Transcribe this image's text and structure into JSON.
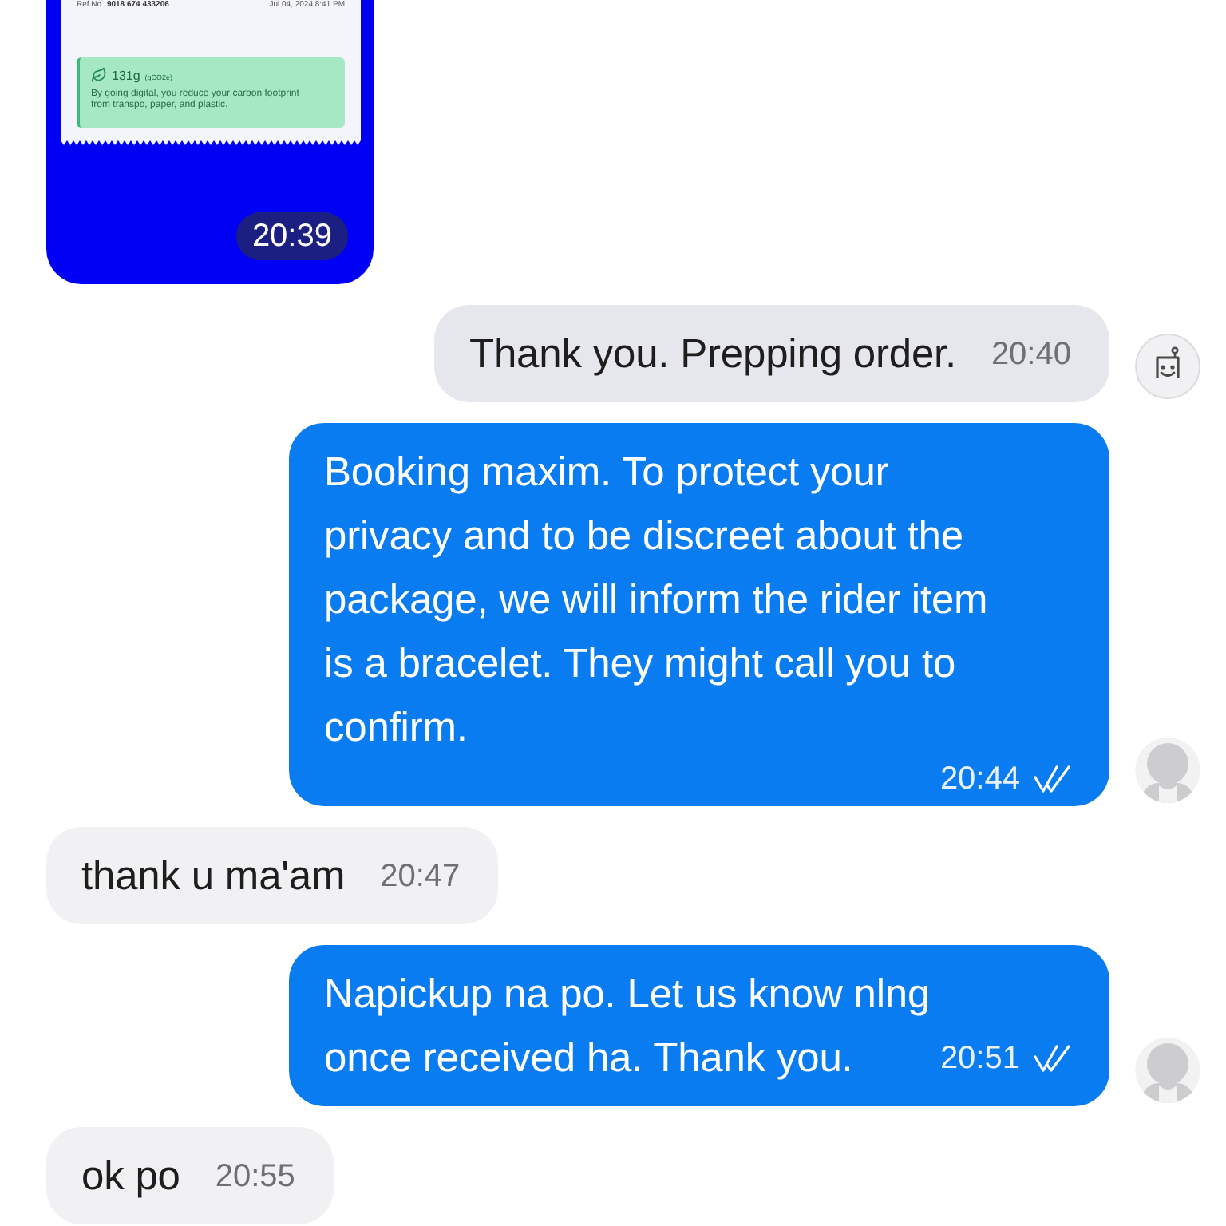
{
  "image_message": {
    "receipt": {
      "ref_label": "Ref No.",
      "ref_number": "9018 674 433206",
      "date": "Jul 04, 2024 8:41 PM",
      "carbon_amount": "131g",
      "carbon_unit": "(gCO2e)",
      "carbon_note": "By going digital, you reduce your carbon footprint from transpo, paper, and plastic."
    },
    "time": "20:39"
  },
  "messages": [
    {
      "kind": "bot",
      "text": "Thank you. Prepping order.",
      "time": "20:40",
      "read": false,
      "avatar": {
        "kind": "bot"
      }
    },
    {
      "kind": "sent",
      "text": "Booking maxim. To protect your privacy and to be discreet about the package, we will inform the rider item is a bracelet. They might call you to confirm.",
      "time": "20:44",
      "read": true,
      "avatar": {
        "kind": "person"
      }
    },
    {
      "kind": "received",
      "text": "thank u ma'am",
      "time": "20:47",
      "read": false
    },
    {
      "kind": "sent",
      "text": "Napickup na po. Let us know nlng once received ha. Thank you.",
      "time": "20:51",
      "read": true,
      "avatar": {
        "kind": "person"
      }
    },
    {
      "kind": "received",
      "text": "ok po",
      "time": "20:55",
      "read": false
    }
  ]
}
